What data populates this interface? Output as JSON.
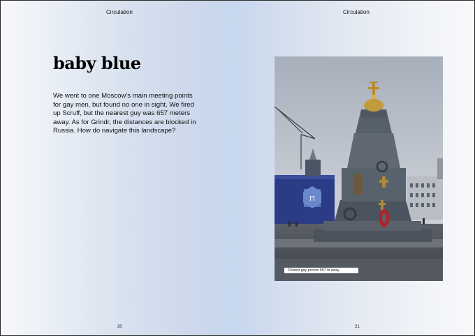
{
  "pages": {
    "left": {
      "running_head": "Circulation",
      "heading": "baby blue",
      "body": "We went to one Moscow’s main meeting points for gay men, but found no one in sight. We fired up Scruff, but the nearest guy was 657 meters away. As for Grindr, the distances are blocked in Russia. How do navigate this landscape?",
      "page_number": "20"
    },
    "right": {
      "running_head": "Circulation",
      "photo_caption": "Closest gay person 657 m away",
      "page_number": "21"
    }
  }
}
